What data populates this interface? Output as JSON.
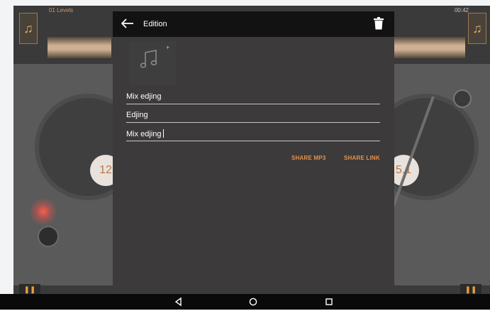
{
  "app": {
    "track_title": "01 Levels",
    "time": "00:42",
    "left_bpm": "12",
    "right_bpm": "5.1"
  },
  "dialog": {
    "title": "Edition",
    "fields": [
      {
        "value": "Mix edjing"
      },
      {
        "value": "Edjing"
      },
      {
        "value": "Mix edjing"
      }
    ],
    "actions": {
      "share_mp3": "SHARE MP3",
      "share_link": "SHARE LINK"
    }
  },
  "colors": {
    "accent": "#e8924a",
    "header": "#121212",
    "dialog_bg": "#3c3a3a"
  },
  "icons": {
    "back": "arrow-left-icon",
    "delete": "trash-icon",
    "cover": "music-note-icon",
    "nav_back": "triangle-back-icon",
    "nav_home": "circle-home-icon",
    "nav_recents": "square-recents-icon"
  }
}
